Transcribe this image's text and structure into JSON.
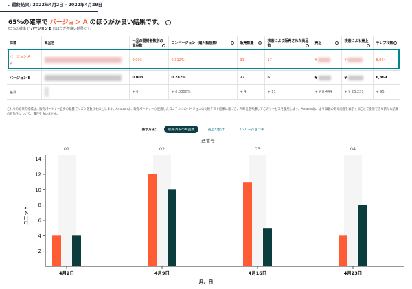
{
  "header": {
    "title": "⌄ 最終結果: 2022年4月2日 - 2022年4月29日"
  },
  "summary": {
    "title_prefix": "65%の確率で",
    "title_accent": "バージョン A",
    "title_suffix": "のほうがか良い結果です。",
    "subtitle_prefix": "65%の確率で",
    "subtitle_bold": "バージョン B",
    "subtitle_suffix": "のほうがか良い結果です。"
  },
  "table": {
    "headers": [
      "採標",
      "商品名",
      "一品の開封者数別の商品数",
      "コンバージョン（購入転換数）",
      "販売数量",
      "検索により販売された商品数",
      "売上",
      "検索による売上",
      "サンプル数"
    ],
    "rows": [
      {
        "label": "バージョン A",
        "check": "✓",
        "cells": [
          "0.003",
          "0.312%",
          "31",
          "17",
          "¥",
          "¥",
          "8,964"
        ]
      },
      {
        "label": "バージョン B",
        "check": "",
        "cells": [
          "0.003",
          "0.282%",
          "27",
          "6",
          "¥",
          "¥",
          "6,869"
        ]
      },
      {
        "label": "差異",
        "check": "",
        "cells": [
          "+ 0",
          "+ 0.0300%",
          "+ 4",
          "+ 11",
          "+ ¥ 8,444",
          "+ ¥ 25,221",
          "+ 95"
        ]
      }
    ]
  },
  "note": "これらの結果の指標は、販売パートナー自身の裁量でリスクを負うものとします。Amazonは、販売パートナーが使用したコンテンツのバージョンの比較テスト結果に基づき、判断仕を考慮してこのサービスを使用します。Amazonは、より価値のある内容を表示することで提供できる新たな結果の有効性について、責任を負いません。",
  "display": {
    "label": "表示方法：",
    "options": [
      {
        "label": "販売済みの商品数",
        "active": true
      },
      {
        "label": "売上の合計",
        "active": false
      },
      {
        "label": "コンバージョン率",
        "active": false
      }
    ]
  },
  "chart_data": {
    "type": "bar",
    "title": "週番号",
    "week_numbers": [
      "01",
      "02",
      "03",
      "04"
    ],
    "categories": [
      "4月2日",
      "4月9日",
      "4月16日",
      "4月23日"
    ],
    "xlabel": "月、日",
    "ylabel": "ユニット",
    "ylim": [
      0,
      14
    ],
    "yticks": [
      2,
      4,
      6,
      8,
      10,
      12,
      14
    ],
    "series": [
      {
        "values": [
          4,
          12,
          11,
          4
        ],
        "color": "#ff5c35"
      },
      {
        "values": [
          4,
          10,
          5,
          8
        ],
        "color": "#0b3d3d"
      }
    ],
    "grid": false,
    "colors": {
      "band": "#f5f5f5",
      "axis": "#333333"
    }
  }
}
